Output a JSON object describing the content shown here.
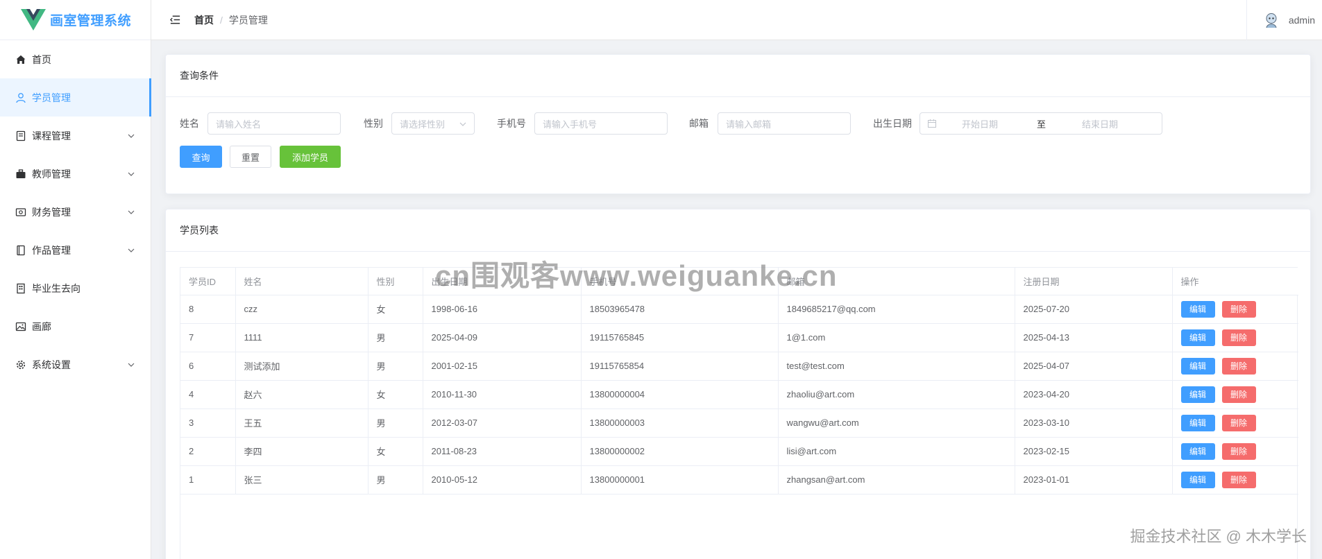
{
  "app": {
    "title": "画室管理系统"
  },
  "sidebar": {
    "items": [
      {
        "label": "首页",
        "icon": "home-icon",
        "active": false,
        "has_children": false
      },
      {
        "label": "学员管理",
        "icon": "user-icon",
        "active": true,
        "has_children": false
      },
      {
        "label": "课程管理",
        "icon": "notebook-icon",
        "active": false,
        "has_children": true
      },
      {
        "label": "教师管理",
        "icon": "briefcase-icon",
        "active": false,
        "has_children": true
      },
      {
        "label": "财务管理",
        "icon": "wallet-icon",
        "active": false,
        "has_children": true
      },
      {
        "label": "作品管理",
        "icon": "book-icon",
        "active": false,
        "has_children": true
      },
      {
        "label": "毕业生去向",
        "icon": "building-icon",
        "active": false,
        "has_children": false
      },
      {
        "label": "画廊",
        "icon": "picture-icon",
        "active": false,
        "has_children": false
      },
      {
        "label": "系统设置",
        "icon": "gear-icon",
        "active": false,
        "has_children": true
      }
    ]
  },
  "header": {
    "breadcrumb": {
      "home": "首页",
      "separator": "/",
      "current": "学员管理"
    },
    "user": {
      "name": "admin"
    }
  },
  "search": {
    "title": "查询条件",
    "name_label": "姓名",
    "name_placeholder": "请输入姓名",
    "gender_label": "性别",
    "gender_placeholder": "请选择性别",
    "phone_label": "手机号",
    "phone_placeholder": "请输入手机号",
    "email_label": "邮箱",
    "email_placeholder": "请输入邮箱",
    "birth_label": "出生日期",
    "start_placeholder": "开始日期",
    "range_separator": "至",
    "end_placeholder": "结束日期",
    "query_button": "查询",
    "reset_button": "重置",
    "add_button": "添加学员"
  },
  "list": {
    "title": "学员列表",
    "columns": [
      "学员ID",
      "姓名",
      "性别",
      "出生日期",
      "手机号",
      "邮箱",
      "注册日期",
      "操作"
    ],
    "edit_label": "编辑",
    "delete_label": "删除",
    "rows": [
      {
        "id": "8",
        "name": "czz",
        "gender": "女",
        "birth": "1998-06-16",
        "phone": "18503965478",
        "email": "1849685217@qq.com",
        "reg": "2025-07-20"
      },
      {
        "id": "7",
        "name": "1111",
        "gender": "男",
        "birth": "2025-04-09",
        "phone": "19115765845",
        "email": "1@1.com",
        "reg": "2025-04-13"
      },
      {
        "id": "6",
        "name": "测试添加",
        "gender": "男",
        "birth": "2001-02-15",
        "phone": "19115765854",
        "email": "test@test.com",
        "reg": "2025-04-07"
      },
      {
        "id": "4",
        "name": "赵六",
        "gender": "女",
        "birth": "2010-11-30",
        "phone": "13800000004",
        "email": "zhaoliu@art.com",
        "reg": "2023-04-20"
      },
      {
        "id": "3",
        "name": "王五",
        "gender": "男",
        "birth": "2012-03-07",
        "phone": "13800000003",
        "email": "wangwu@art.com",
        "reg": "2023-03-10"
      },
      {
        "id": "2",
        "name": "李四",
        "gender": "女",
        "birth": "2011-08-23",
        "phone": "13800000002",
        "email": "lisi@art.com",
        "reg": "2023-02-15"
      },
      {
        "id": "1",
        "name": "张三",
        "gender": "男",
        "birth": "2010-05-12",
        "phone": "13800000001",
        "email": "zhangsan@art.com",
        "reg": "2023-01-01"
      }
    ]
  },
  "watermarks": {
    "center": "cn围观客www.weiguanke.cn",
    "corner": "掘金技术社区 @ 木木学长"
  },
  "colors": {
    "primary": "#409eff",
    "success": "#67c23a",
    "danger": "#f56c6c",
    "logo_green": "#42b883",
    "logo_dark": "#35495e"
  }
}
